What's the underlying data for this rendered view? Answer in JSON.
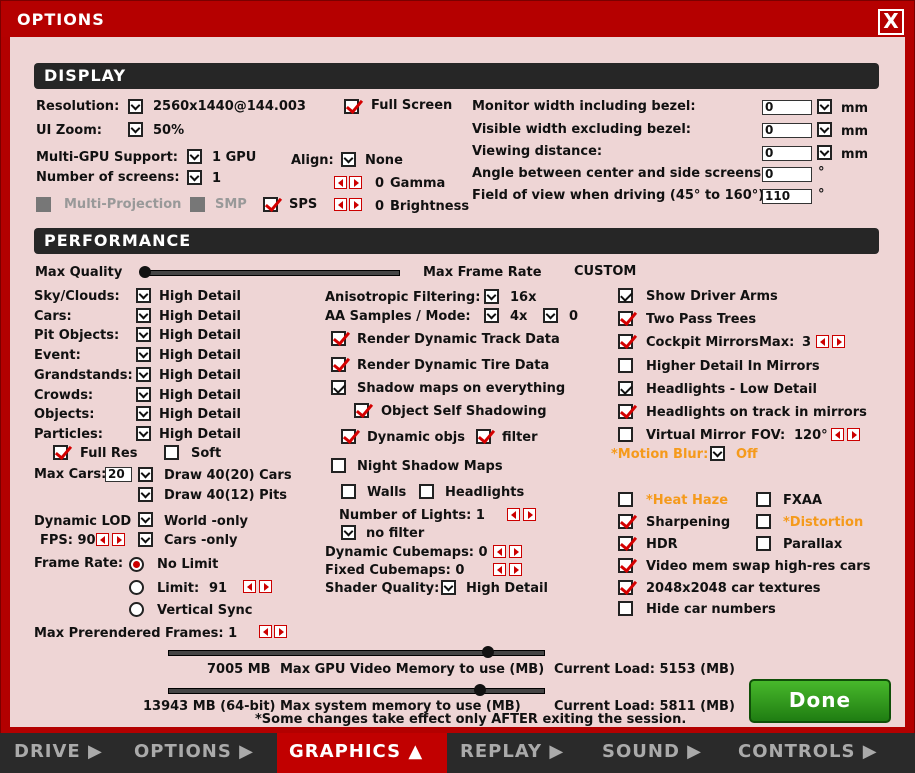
{
  "window": {
    "title": "OPTIONS",
    "close_label": "X"
  },
  "display": {
    "heading": "DISPLAY",
    "resolution_label": "Resolution:",
    "resolution_value": "2560x1440@144.003",
    "full_screen_label": "Full Screen",
    "ui_zoom_label": "UI Zoom:",
    "ui_zoom_value": "50%",
    "multi_gpu_label": "Multi-GPU Support:",
    "multi_gpu_value": "1 GPU",
    "num_screens_label": "Number of screens:",
    "num_screens_value": "1",
    "align_label": "Align:",
    "align_value": "None",
    "gamma_value": "0",
    "gamma_label": "Gamma",
    "brightness_value": "0",
    "brightness_label": "Brightness",
    "multi_projection_label": "Multi-Projection",
    "smp_label": "SMP",
    "sps_label": "SPS",
    "monitor_width_label": "Monitor width including bezel:",
    "monitor_width_value": "0",
    "visible_width_label": "Visible width excluding bezel:",
    "visible_width_value": "0",
    "viewing_distance_label": "Viewing distance:",
    "viewing_distance_value": "0",
    "angle_label": "Angle between center and side screens:",
    "angle_value": "0",
    "fov_label": "Field of view when driving (45° to 160°):",
    "fov_value": "110",
    "unit_mm": "mm",
    "unit_deg": "°"
  },
  "performance": {
    "heading": "PERFORMANCE",
    "max_quality_label": "Max Quality",
    "max_frame_rate_label": "Max Frame Rate",
    "custom_label": "CUSTOM",
    "detail_rows": [
      {
        "label": "Sky/Clouds:",
        "value": "High Detail"
      },
      {
        "label": "Cars:",
        "value": "High Detail"
      },
      {
        "label": "Pit Objects:",
        "value": "High Detail"
      },
      {
        "label": "Event:",
        "value": "High Detail"
      },
      {
        "label": "Grandstands:",
        "value": "High Detail"
      },
      {
        "label": "Crowds:",
        "value": "High Detail"
      },
      {
        "label": "Objects:",
        "value": "High Detail"
      },
      {
        "label": "Particles:",
        "value": "High Detail"
      }
    ],
    "full_res_label": "Full Res",
    "soft_label": "Soft",
    "max_cars_label": "Max Cars:",
    "max_cars_value": "20",
    "draw_cars_label": "Draw 40(20) Cars",
    "draw_pits_label": "Draw 40(12) Pits",
    "dynamic_lod_label": "Dynamic LOD",
    "dynamic_lod_value": "World -only",
    "fps_label": "FPS: 90",
    "fps_cars_value": "Cars -only",
    "frame_rate_label": "Frame Rate:",
    "no_limit_label": "No Limit",
    "limit_label": "Limit:",
    "limit_value": "91",
    "vsync_label": "Vertical Sync",
    "max_prerendered_label": "Max Prerendered Frames: 1",
    "aniso_label": "Anisotropic Filtering:",
    "aniso_value": "16x",
    "aa_label": "AA Samples / Mode:",
    "aa_samples_value": "4x",
    "aa_mode_value": "0",
    "render_track_label": "Render Dynamic Track Data",
    "render_tire_label": "Render Dynamic Tire Data",
    "shadow_maps_label": "Shadow maps on everything",
    "self_shadow_label": "Object Self Shadowing",
    "dynamic_objs_label": "Dynamic objs",
    "filter_label": "filter",
    "night_shadow_label": "Night Shadow Maps",
    "walls_label": "Walls",
    "headlights_label": "Headlights",
    "num_lights_label": "Number of Lights: 1",
    "no_filter_label": "no filter",
    "dyn_cubemaps_label": "Dynamic Cubemaps: 0",
    "fixed_cubemaps_label": "Fixed Cubemaps: 0",
    "shader_quality_label": "Shader Quality:",
    "shader_quality_value": "High Detail",
    "show_driver_arms_label": "Show Driver Arms",
    "two_pass_trees_label": "Two Pass Trees",
    "cockpit_mirrors_label": "Cockpit Mirrors",
    "cockpit_mirrors_max_label": "Max:",
    "cockpit_mirrors_max_value": "3",
    "higher_detail_mirrors_label": "Higher Detail In Mirrors",
    "headlights_low_label": "Headlights - Low Detail",
    "headlights_track_label": "Headlights on track in mirrors",
    "virtual_mirror_label": "Virtual Mirror",
    "virtual_fov_label": "FOV:",
    "virtual_fov_value": "120°",
    "motion_blur_label": "*Motion Blur:",
    "motion_blur_value": "Off",
    "heat_haze_label": "*Heat Haze",
    "fxaa_label": "FXAA",
    "sharpening_label": "Sharpening",
    "distortion_label": "*Distortion",
    "hdr_label": "HDR",
    "parallax_label": "Parallax",
    "video_mem_swap_label": "Video mem swap high-res cars",
    "car_textures_label": "2048x2048 car textures",
    "hide_car_numbers_label": "Hide car numbers",
    "gpu_mem_value": "7005 MB",
    "gpu_mem_label": "Max GPU Video Memory to use (MB)",
    "gpu_load_label": "Current Load: 5153 (MB)",
    "sys_mem_value": "13943 MB (64-bit)",
    "sys_mem_label": "Max system memory to use (MB)",
    "sys_load_label": "Current Load: 5811 (MB)",
    "note": "*Some changes take effect only AFTER exiting the session.",
    "max_quality_level": 0,
    "gpu_mem_level": 0.85,
    "sys_mem_level": 0.83
  },
  "done_label": "Done",
  "tabs": [
    {
      "label": "DRIVE"
    },
    {
      "label": "OPTIONS"
    },
    {
      "label": "GRAPHICS"
    },
    {
      "label": "REPLAY"
    },
    {
      "label": "SOUND"
    },
    {
      "label": "CONTROLS"
    }
  ],
  "colors": {
    "accent": "#b30000",
    "done": "#2e9a1a",
    "note": "#f59a1b"
  }
}
